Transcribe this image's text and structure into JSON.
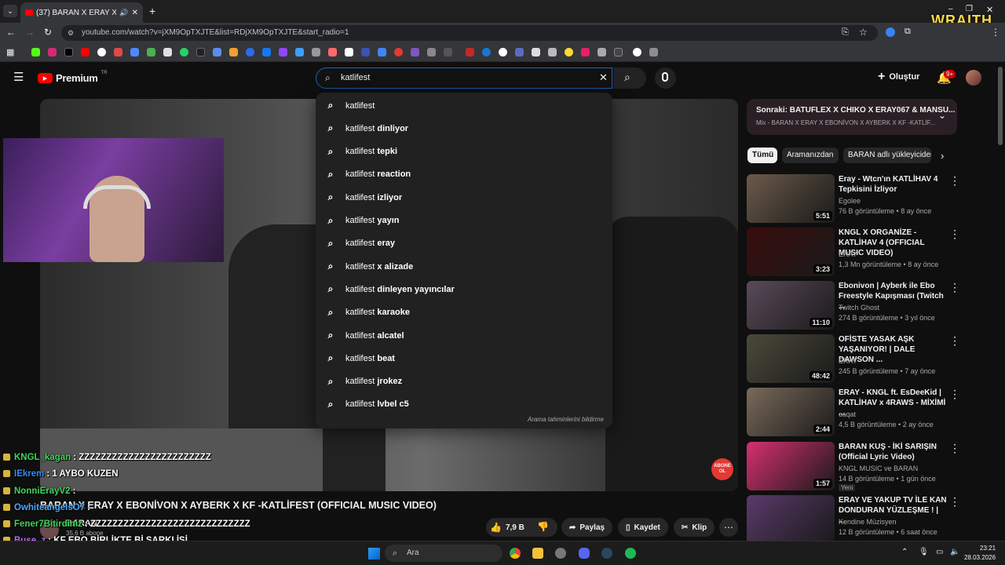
{
  "browser": {
    "tab_title": "(37) BARAN X ERAY X EBON",
    "url": "youtube.com/watch?v=jXM9OpTXJTE&list=RDjXM9OpTXJTE&start_radio=1",
    "overlay_logo": "WRAITH"
  },
  "header": {
    "logo_text": "Premium",
    "logo_region": "TR",
    "search_value": "katlifest",
    "create_label": "Oluştur",
    "notif_count": "9+"
  },
  "suggestions": {
    "items": [
      {
        "prefix": "katlifest",
        "suffix": ""
      },
      {
        "prefix": "katlifest",
        "suffix": " dinliyor"
      },
      {
        "prefix": "katlifest",
        "suffix": " tepki"
      },
      {
        "prefix": "katlifest",
        "suffix": " reaction"
      },
      {
        "prefix": "katlifest",
        "suffix": " izliyor"
      },
      {
        "prefix": "katlifest",
        "suffix": " yayın"
      },
      {
        "prefix": "katlifest",
        "suffix": " eray"
      },
      {
        "prefix": "katlifest",
        "suffix": " x alizade"
      },
      {
        "prefix": "katlifest",
        "suffix": " dinleyen yayıncılar"
      },
      {
        "prefix": "katlifest",
        "suffix": " karaoke"
      },
      {
        "prefix": "katlifest",
        "suffix": " alcatel"
      },
      {
        "prefix": "katlifest",
        "suffix": " beat"
      },
      {
        "prefix": "katlifest",
        "suffix": " jrokez"
      },
      {
        "prefix": "katlifest",
        "suffix": " lvbel c5"
      }
    ],
    "report_label": "Arama tahminlerini bildirme"
  },
  "video": {
    "title": "BARAN X ERAY X EBONİVON X AYBERK X KF -KATLİFEST (OFFICIAL MUSIC VIDEO)",
    "channel": "BARAN",
    "subscribers": "35,6 B abone",
    "subscribe_overlay": "ABONE OL",
    "like_count": "7,9 B",
    "share_label": "Paylaş",
    "save_label": "Kaydet",
    "clip_label": "Klip"
  },
  "chat": [
    {
      "user": "KNGL_kagan",
      "msg": ": ZZZZZZZZZZZZZZZZZZZZZZZZ",
      "color": "#3fd65c"
    },
    {
      "user": "IEkrem",
      "msg": ": 1 AYBO KUZEN",
      "color": "#2f8cff"
    },
    {
      "user": "NonniErayV2",
      "msg": ":",
      "color": "#3fd65c"
    },
    {
      "user": "OwhiteangelsO7",
      "msg": ":",
      "color": "#4aa8ff"
    },
    {
      "user": "Fener7Bitirdiniz",
      "msg": ": ZZZZZZZZZZZZZZZZZZZZZZZZZZZZZ",
      "color": "#3fd65c"
    },
    {
      "user": "Buse_z",
      "msg": ": KF EBO BİRLİKTE Bİ ŞARKI İŞİ",
      "color": "#c36bff"
    },
    {
      "user": "mert_cw",
      "msg": ": ZZZZZZZZZZZZZZZZZZZZZZZZZZZZZZZZ",
      "color": "#ff6b6b"
    }
  ],
  "playlist": {
    "next_label": "Sonraki: BATUFLEX X CHIKO X ERAY067 & MANSU...",
    "mix_label": "Mix - BARAN X ERAY X EBONİVON X AYBERK X KF -KATLİF..."
  },
  "chips": [
    "Tümü",
    "Aramanızdan",
    "BARAN adlı yükleyiciden"
  ],
  "related": [
    {
      "title": "Eray - Wtcn'ın KATLİHAV 4 Tepkisini İzliyor",
      "channel": "Egolee",
      "meta": "76 B görüntüleme • 8 ay önce",
      "duration": "5:51",
      "badge": "",
      "thumb": "#6b5a4a"
    },
    {
      "title": "KNGL X ORGANİZE - KATLİHAV 4 (OFFICIAL MUSIC VIDEO)",
      "channel": "ERAY",
      "meta": "1,3 Mn görüntüleme • 8 ay önce",
      "duration": "3:23",
      "badge": "",
      "thumb": "#3a0d0d"
    },
    {
      "title": "Ebonivon | Ayberk ile Ebo Freestyle Kapışması (Twitch ...",
      "channel": "Twitch Ghost",
      "meta": "274 B görüntüleme • 3 yıl önce",
      "duration": "11:10",
      "badge": "",
      "thumb": "#5a4a5a"
    },
    {
      "title": "OFİSTE YASAK AŞK YAŞANIYOR! | DALE DAWSON ...",
      "channel": "ERAY",
      "meta": "245 B görüntüleme • 7 ay önce",
      "duration": "48:42",
      "badge": "",
      "thumb": "#4a4a3a"
    },
    {
      "title": "ERAY - KNGL ft. EsDeeKid | KATLİHAV x 4RAWS - MİXİMİ ...",
      "channel": "caqat",
      "meta": "4,5 B görüntüleme • 2 ay önce",
      "duration": "2:44",
      "badge": "",
      "thumb": "#7a6a5a"
    },
    {
      "title": "BARAN KUŞ - İKİ SARIŞIN (Official Lyric Video)",
      "channel": "KNGL MUSIC ve BARAN",
      "meta": "14 B görüntüleme • 1 gün önce",
      "duration": "1:57",
      "badge": "Yeni",
      "thumb": "#d6306f"
    },
    {
      "title": "ERAY VE YAKUP TV İLE KAN DONDURAN YÜZLEŞME ! | ...",
      "channel": "Kendine Müzisyen",
      "meta": "12 B görüntüleme • 6 saat önce",
      "duration": "",
      "badge": "",
      "thumb": "#5a3a6a"
    }
  ],
  "taskbar": {
    "search_placeholder": "Ara",
    "time": "23:21",
    "date": "28.03.2026"
  }
}
